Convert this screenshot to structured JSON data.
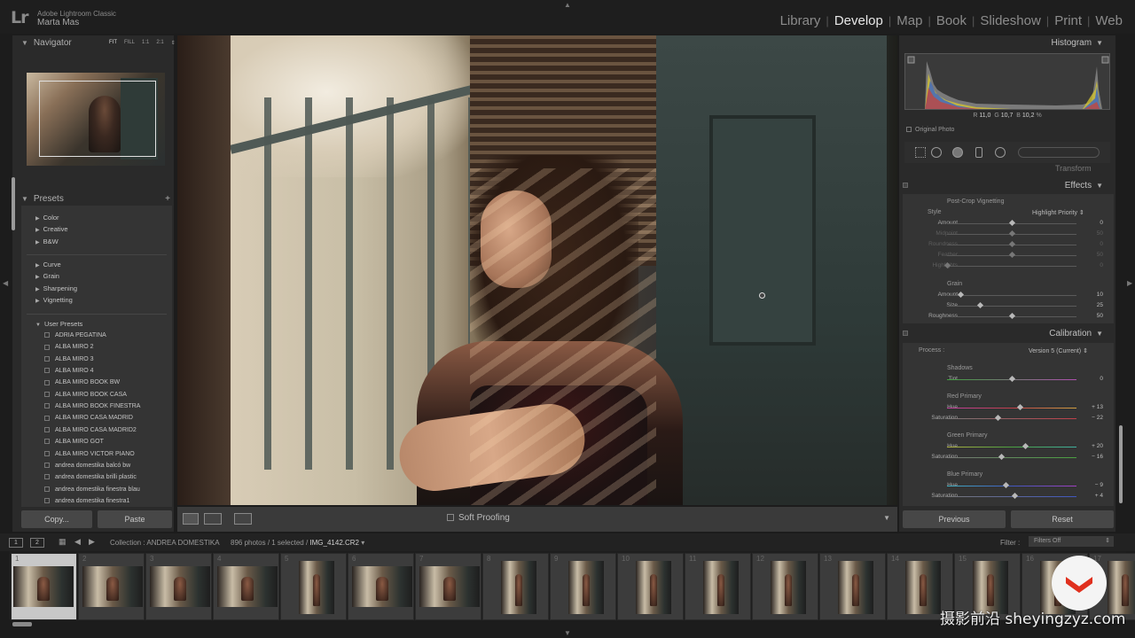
{
  "app": {
    "logo": "Lr",
    "name": "Adobe Lightroom Classic",
    "user": "Marta Mas"
  },
  "modules": [
    {
      "label": "Library",
      "active": false
    },
    {
      "label": "Develop",
      "active": true
    },
    {
      "label": "Map",
      "active": false
    },
    {
      "label": "Book",
      "active": false
    },
    {
      "label": "Slideshow",
      "active": false
    },
    {
      "label": "Print",
      "active": false
    },
    {
      "label": "Web",
      "active": false
    }
  ],
  "navigator": {
    "title": "Navigator",
    "zoom_options": [
      "FIT",
      "FILL",
      "1:1",
      "2:1"
    ],
    "active_zoom": "FIT"
  },
  "presets": {
    "title": "Presets",
    "add": "+",
    "group1": [
      "Color",
      "Creative",
      "B&W"
    ],
    "group2": [
      "Curve",
      "Grain",
      "Sharpening",
      "Vignetting"
    ],
    "user_title": "User Presets",
    "user_items": [
      "ADRIA PEGATINA",
      "ALBA MIRO 2",
      "ALBA MIRO 3",
      "ALBA MIRO 4",
      "ALBA MIRO BOOK BW",
      "ALBA MIRO BOOK CASA",
      "ALBA MIRO BOOK FINESTRA",
      "ALBA MIRO CASA MADRID",
      "ALBA MIRO CASA MADRID2",
      "ALBA MIRO GOT",
      "ALBA MIRO VICTOR PIANO",
      "andrea domestika balcó bw",
      "andrea domestika brilli plastic",
      "andrea domestika finestra blau",
      "andrea domestika finestra1"
    ]
  },
  "left_buttons": {
    "copy": "Copy...",
    "paste": "Paste"
  },
  "toolbar": {
    "soft_proofing": "Soft Proofing"
  },
  "histogram": {
    "title": "Histogram",
    "readout": {
      "r_label": "R",
      "r": "11,0",
      "g_label": "G",
      "g": "10,7",
      "b_label": "B",
      "b": "10,2",
      "unit": "%"
    },
    "original_photo": "Original Photo"
  },
  "transform": {
    "title": "Transform"
  },
  "effects": {
    "title": "Effects",
    "vignette_title": "Post-Crop Vignetting",
    "style_label": "Style",
    "style_value": "Highlight Priority",
    "vignette_sliders": [
      {
        "label": "Amount",
        "value": "0",
        "pos": 0.5,
        "dim": false
      },
      {
        "label": "Midpoint",
        "value": "50",
        "pos": 0.5,
        "dim": true
      },
      {
        "label": "Roundness",
        "value": "0",
        "pos": 0.5,
        "dim": true
      },
      {
        "label": "Feather",
        "value": "50",
        "pos": 0.5,
        "dim": true
      },
      {
        "label": "Highlights",
        "value": "0",
        "pos": 0.0,
        "dim": true
      }
    ],
    "grain_title": "Grain",
    "grain_sliders": [
      {
        "label": "Amount",
        "value": "10",
        "pos": 0.1,
        "dim": false
      },
      {
        "label": "Size",
        "value": "25",
        "pos": 0.25,
        "dim": false
      },
      {
        "label": "Roughness",
        "value": "50",
        "pos": 0.5,
        "dim": false
      }
    ]
  },
  "calibration": {
    "title": "Calibration",
    "process_label": "Process :",
    "process_value": "Version 5 (Current)",
    "shadows_title": "Shadows",
    "shadows_tint": {
      "label": "Tint",
      "value": "0",
      "pos": 0.5
    },
    "red_title": "Red Primary",
    "red": [
      {
        "label": "Hue",
        "value": "+ 13",
        "pos": 0.565
      },
      {
        "label": "Saturation",
        "value": "− 22",
        "pos": 0.39
      }
    ],
    "green_title": "Green Primary",
    "green": [
      {
        "label": "Hue",
        "value": "+ 20",
        "pos": 0.6
      },
      {
        "label": "Saturation",
        "value": "− 16",
        "pos": 0.42
      }
    ],
    "blue_title": "Blue Primary",
    "blue": [
      {
        "label": "Hue",
        "value": "− 9",
        "pos": 0.455
      },
      {
        "label": "Saturation",
        "value": "+ 4",
        "pos": 0.52
      }
    ]
  },
  "right_buttons": {
    "previous": "Previous",
    "reset": "Reset"
  },
  "filmstrip": {
    "screen1": "1",
    "screen2": "2",
    "collection_label": "Collection : ANDREA DOMESTIKA",
    "count": "896 photos / 1 selected /",
    "filename": "IMG_4142.CR2",
    "filter_label": "Filter :",
    "filter_value": "Filters Off",
    "cells": [
      {
        "num": "1",
        "portrait": false,
        "selected": true
      },
      {
        "num": "2",
        "portrait": false
      },
      {
        "num": "3",
        "portrait": false
      },
      {
        "num": "4",
        "portrait": false
      },
      {
        "num": "5",
        "portrait": true
      },
      {
        "num": "6",
        "portrait": false
      },
      {
        "num": "7",
        "portrait": false
      },
      {
        "num": "8",
        "portrait": true
      },
      {
        "num": "9",
        "portrait": true
      },
      {
        "num": "10",
        "portrait": true
      },
      {
        "num": "11",
        "portrait": true
      },
      {
        "num": "12",
        "portrait": true
      },
      {
        "num": "13",
        "portrait": true
      },
      {
        "num": "14",
        "portrait": true
      },
      {
        "num": "15",
        "portrait": true
      },
      {
        "num": "16",
        "portrait": true
      },
      {
        "num": "17",
        "portrait": true
      }
    ]
  },
  "watermark": "摄影前沿 sheyingzyz.com",
  "colors": {
    "red_track": "#c0404a",
    "green_track": "#4aa040",
    "blue_track": "#4058c0",
    "tint_track": "#b050b0"
  }
}
